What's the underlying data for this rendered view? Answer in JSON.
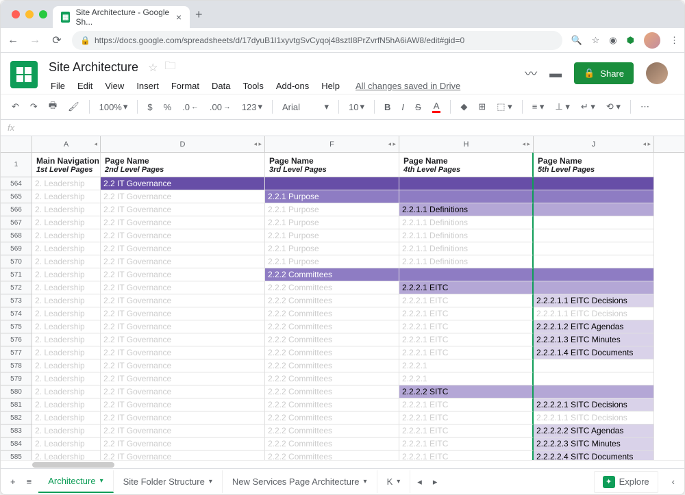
{
  "browser": {
    "tab_title": "Site Architecture - Google Sh...",
    "url": "https://docs.google.com/spreadsheets/d/17dyuB1l1xyvtgSvCyqoj48sztI8PrZvrfN5hA6iAW8/edit#gid=0"
  },
  "doc": {
    "title": "Site Architecture",
    "save_status": "All changes saved in Drive"
  },
  "menu": [
    "File",
    "Edit",
    "View",
    "Insert",
    "Format",
    "Data",
    "Tools",
    "Add-ons",
    "Help"
  ],
  "toolbar": {
    "zoom": "100%",
    "currency": "$",
    "percent": "%",
    "dec_dec": ".0",
    "dec_inc": ".00",
    "more_fmt": "123",
    "font": "Arial",
    "size": "10"
  },
  "share": {
    "label": "Share"
  },
  "columns": [
    {
      "letter": "A",
      "width": "col-A",
      "head": "Main Navigation",
      "sub": "1st Level Pages"
    },
    {
      "letter": "D",
      "width": "col-D",
      "head": "Page Name",
      "sub": "2nd Level Pages"
    },
    {
      "letter": "F",
      "width": "col-F",
      "head": "Page Name",
      "sub": "3rd Level Pages"
    },
    {
      "letter": "H",
      "width": "col-H",
      "head": "Page Name",
      "sub": "4th Level Pages"
    },
    {
      "letter": "J",
      "width": "col-J",
      "head": "Page Name",
      "sub": "5th Level Pages"
    }
  ],
  "rows": [
    {
      "n": 564,
      "cells": [
        {
          "t": "2. Leadership",
          "c": "ghost"
        },
        {
          "t": "2.2 IT Governance",
          "c": "hl-dark"
        },
        {
          "t": "",
          "c": "hl-dark"
        },
        {
          "t": "",
          "c": "hl-dark"
        },
        {
          "t": "",
          "c": "hl-dark"
        }
      ]
    },
    {
      "n": 565,
      "cells": [
        {
          "t": "2. Leadership",
          "c": "ghost"
        },
        {
          "t": "2.2 IT Governance",
          "c": "ghost"
        },
        {
          "t": "2.2.1 Purpose",
          "c": "hl-med"
        },
        {
          "t": "",
          "c": "hl-med"
        },
        {
          "t": "",
          "c": "hl-med"
        }
      ]
    },
    {
      "n": 566,
      "cells": [
        {
          "t": "2. Leadership",
          "c": "ghost"
        },
        {
          "t": "2.2 IT Governance",
          "c": "ghost"
        },
        {
          "t": "2.2.1 Purpose",
          "c": "ghost"
        },
        {
          "t": "2.2.1.1 Definitions",
          "c": "hl-light"
        },
        {
          "t": "",
          "c": "hl-light"
        }
      ]
    },
    {
      "n": 567,
      "cells": [
        {
          "t": "2. Leadership",
          "c": "ghost"
        },
        {
          "t": "2.2 IT Governance",
          "c": "ghost"
        },
        {
          "t": "2.2.1 Purpose",
          "c": "ghost"
        },
        {
          "t": "2.2.1.1 Definitions",
          "c": "ghost"
        },
        {
          "t": "",
          "c": ""
        }
      ]
    },
    {
      "n": 568,
      "cells": [
        {
          "t": "2. Leadership",
          "c": "ghost"
        },
        {
          "t": "2.2 IT Governance",
          "c": "ghost"
        },
        {
          "t": "2.2.1 Purpose",
          "c": "ghost"
        },
        {
          "t": "2.2.1.1 Definitions",
          "c": "ghost"
        },
        {
          "t": "",
          "c": ""
        }
      ]
    },
    {
      "n": 569,
      "cells": [
        {
          "t": "2. Leadership",
          "c": "ghost"
        },
        {
          "t": "2.2 IT Governance",
          "c": "ghost"
        },
        {
          "t": "2.2.1 Purpose",
          "c": "ghost"
        },
        {
          "t": "2.2.1.1 Definitions",
          "c": "ghost"
        },
        {
          "t": "",
          "c": ""
        }
      ]
    },
    {
      "n": 570,
      "cells": [
        {
          "t": "2. Leadership",
          "c": "ghost"
        },
        {
          "t": "2.2 IT Governance",
          "c": "ghost"
        },
        {
          "t": "2.2.1 Purpose",
          "c": "ghost"
        },
        {
          "t": "2.2.1.1 Definitions",
          "c": "ghost"
        },
        {
          "t": "",
          "c": ""
        }
      ]
    },
    {
      "n": 571,
      "cells": [
        {
          "t": "2. Leadership",
          "c": "ghost"
        },
        {
          "t": "2.2 IT Governance",
          "c": "ghost"
        },
        {
          "t": "2.2.2 Committees",
          "c": "hl-med"
        },
        {
          "t": "",
          "c": "hl-med"
        },
        {
          "t": "",
          "c": "hl-med"
        }
      ]
    },
    {
      "n": 572,
      "cells": [
        {
          "t": "2. Leadership",
          "c": "ghost"
        },
        {
          "t": "2.2 IT Governance",
          "c": "ghost"
        },
        {
          "t": "2.2.2 Committees",
          "c": "ghost"
        },
        {
          "t": "2.2.2.1 EITC",
          "c": "hl-light"
        },
        {
          "t": "",
          "c": "hl-light"
        }
      ]
    },
    {
      "n": 573,
      "cells": [
        {
          "t": "2. Leadership",
          "c": "ghost"
        },
        {
          "t": "2.2 IT Governance",
          "c": "ghost"
        },
        {
          "t": "2.2.2 Committees",
          "c": "ghost"
        },
        {
          "t": "2.2.2.1 EITC",
          "c": "ghost"
        },
        {
          "t": "2.2.2.1.1 EITC Decisions",
          "c": "hl-vlight"
        }
      ]
    },
    {
      "n": 574,
      "cells": [
        {
          "t": "2. Leadership",
          "c": "ghost"
        },
        {
          "t": "2.2 IT Governance",
          "c": "ghost"
        },
        {
          "t": "2.2.2 Committees",
          "c": "ghost"
        },
        {
          "t": "2.2.2.1 EITC",
          "c": "ghost"
        },
        {
          "t": "2.2.2.1.1 EITC Decisions",
          "c": "ghost"
        }
      ]
    },
    {
      "n": 575,
      "cells": [
        {
          "t": "2. Leadership",
          "c": "ghost"
        },
        {
          "t": "2.2 IT Governance",
          "c": "ghost"
        },
        {
          "t": "2.2.2 Committees",
          "c": "ghost"
        },
        {
          "t": "2.2.2.1 EITC",
          "c": "ghost"
        },
        {
          "t": "2.2.2.1.2 EITC Agendas",
          "c": "hl-vlight"
        }
      ]
    },
    {
      "n": 576,
      "cells": [
        {
          "t": "2. Leadership",
          "c": "ghost"
        },
        {
          "t": "2.2 IT Governance",
          "c": "ghost"
        },
        {
          "t": "2.2.2 Committees",
          "c": "ghost"
        },
        {
          "t": "2.2.2.1 EITC",
          "c": "ghost"
        },
        {
          "t": "2.2.2.1.3 EITC Minutes",
          "c": "hl-vlight"
        }
      ]
    },
    {
      "n": 577,
      "cells": [
        {
          "t": "2. Leadership",
          "c": "ghost"
        },
        {
          "t": "2.2 IT Governance",
          "c": "ghost"
        },
        {
          "t": "2.2.2 Committees",
          "c": "ghost"
        },
        {
          "t": "2.2.2.1 EITC",
          "c": "ghost"
        },
        {
          "t": "2.2.2.1.4 EITC Documents",
          "c": "hl-vlight"
        }
      ]
    },
    {
      "n": 578,
      "cells": [
        {
          "t": "2. Leadership",
          "c": "ghost"
        },
        {
          "t": "2.2 IT Governance",
          "c": "ghost"
        },
        {
          "t": "2.2.2 Committees",
          "c": "ghost"
        },
        {
          "t": "2.2.2.1",
          "c": "ghost"
        },
        {
          "t": "",
          "c": ""
        }
      ]
    },
    {
      "n": 579,
      "cells": [
        {
          "t": "2. Leadership",
          "c": "ghost"
        },
        {
          "t": "2.2 IT Governance",
          "c": "ghost"
        },
        {
          "t": "2.2.2 Committees",
          "c": "ghost"
        },
        {
          "t": "2.2.2.1",
          "c": "ghost"
        },
        {
          "t": "",
          "c": ""
        }
      ]
    },
    {
      "n": 580,
      "cells": [
        {
          "t": "2. Leadership",
          "c": "ghost"
        },
        {
          "t": "2.2 IT Governance",
          "c": "ghost"
        },
        {
          "t": "2.2.2 Committees",
          "c": "ghost"
        },
        {
          "t": "2.2.2.2 SITC",
          "c": "hl-light"
        },
        {
          "t": "",
          "c": "hl-light"
        }
      ]
    },
    {
      "n": 581,
      "cells": [
        {
          "t": "2. Leadership",
          "c": "ghost"
        },
        {
          "t": "2.2 IT Governance",
          "c": "ghost"
        },
        {
          "t": "2.2.2 Committees",
          "c": "ghost"
        },
        {
          "t": "2.2.2.1 EITC",
          "c": "ghost"
        },
        {
          "t": "2.2.2.2.1 SITC Decisions",
          "c": "hl-vlight"
        }
      ]
    },
    {
      "n": 582,
      "cells": [
        {
          "t": "2. Leadership",
          "c": "ghost"
        },
        {
          "t": "2.2 IT Governance",
          "c": "ghost"
        },
        {
          "t": "2.2.2 Committees",
          "c": "ghost"
        },
        {
          "t": "2.2.2.1 EITC",
          "c": "ghost"
        },
        {
          "t": "2.2.2.1.1 SITC Decisions",
          "c": "ghost"
        }
      ]
    },
    {
      "n": 583,
      "cells": [
        {
          "t": "2. Leadership",
          "c": "ghost"
        },
        {
          "t": "2.2 IT Governance",
          "c": "ghost"
        },
        {
          "t": "2.2.2 Committees",
          "c": "ghost"
        },
        {
          "t": "2.2.2.1 EITC",
          "c": "ghost"
        },
        {
          "t": "2.2.2.2.2 SITC Agendas",
          "c": "hl-vlight"
        }
      ]
    },
    {
      "n": 584,
      "cells": [
        {
          "t": "2. Leadership",
          "c": "ghost"
        },
        {
          "t": "2.2 IT Governance",
          "c": "ghost"
        },
        {
          "t": "2.2.2 Committees",
          "c": "ghost"
        },
        {
          "t": "2.2.2.1 EITC",
          "c": "ghost"
        },
        {
          "t": "2.2.2.2.3 SITC Minutes",
          "c": "hl-vlight"
        }
      ]
    },
    {
      "n": 585,
      "cells": [
        {
          "t": "2. Leadership",
          "c": "ghost"
        },
        {
          "t": "2.2 IT Governance",
          "c": "ghost"
        },
        {
          "t": "2.2.2 Committees",
          "c": "ghost"
        },
        {
          "t": "2.2.2.1 EITC",
          "c": "ghost"
        },
        {
          "t": "2.2.2.2.4 SITC Documents",
          "c": "hl-vlight"
        }
      ]
    }
  ],
  "sheet_tabs": [
    {
      "label": "Architecture",
      "active": true
    },
    {
      "label": "Site Folder Structure"
    },
    {
      "label": "New Services Page Architecture"
    },
    {
      "label": "K"
    }
  ],
  "explore": {
    "label": "Explore"
  },
  "header_row_num": "1"
}
